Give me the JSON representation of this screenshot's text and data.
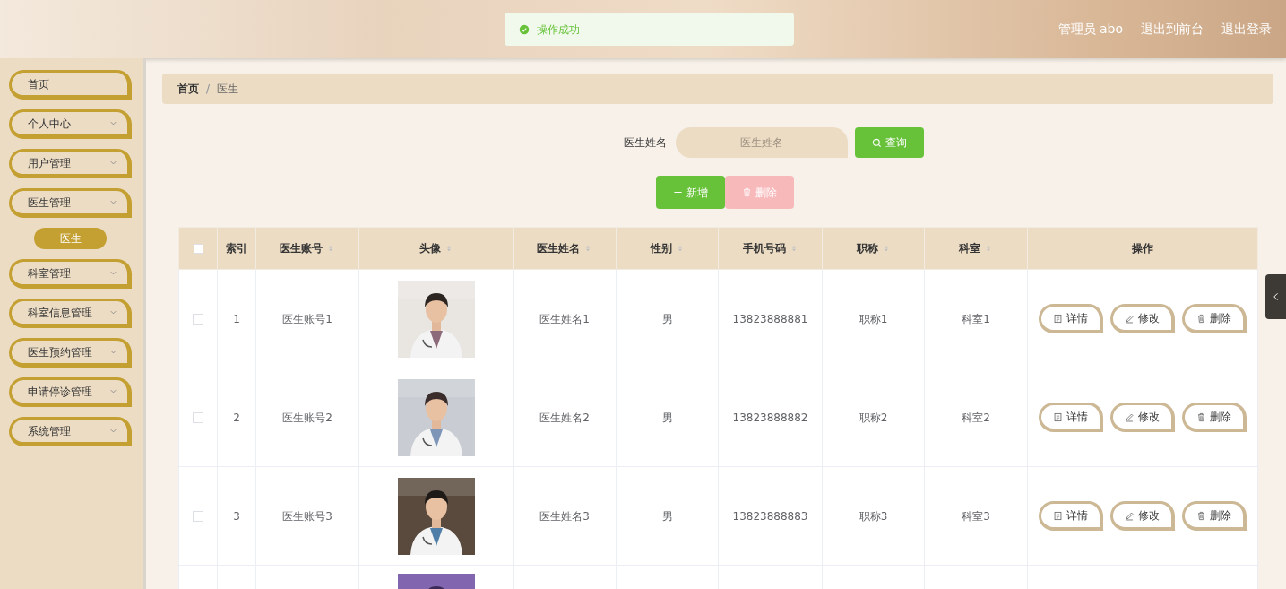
{
  "header": {
    "links": [
      "管理员 abo",
      "退出到前台",
      "退出登录"
    ]
  },
  "toast": {
    "message": "操作成功"
  },
  "sidebar": {
    "items": [
      {
        "label": "首页",
        "expandable": false
      },
      {
        "label": "个人中心",
        "expandable": true
      },
      {
        "label": "用户管理",
        "expandable": true
      },
      {
        "label": "医生管理",
        "expandable": true,
        "children": [
          {
            "label": "医生",
            "selected": true
          }
        ]
      },
      {
        "label": "科室管理",
        "expandable": true
      },
      {
        "label": "科室信息管理",
        "expandable": true
      },
      {
        "label": "医生预约管理",
        "expandable": true
      },
      {
        "label": "申请停诊管理",
        "expandable": true
      },
      {
        "label": "系统管理",
        "expandable": true
      }
    ]
  },
  "breadcrumb": {
    "separator": "/",
    "items": [
      "首页",
      "医生"
    ]
  },
  "search": {
    "label": "医生姓名",
    "placeholder": "医生姓名",
    "button": "查询"
  },
  "actions": [
    {
      "label": "新增",
      "kind": "add",
      "disabled": false
    },
    {
      "label": "删除",
      "kind": "delete",
      "disabled": true
    }
  ],
  "table": {
    "all_checked": false,
    "columns": [
      {
        "label": "索引",
        "sortable": false
      },
      {
        "label": "医生账号",
        "sortable": true
      },
      {
        "label": "头像",
        "sortable": true
      },
      {
        "label": "医生姓名",
        "sortable": true
      },
      {
        "label": "性别",
        "sortable": true
      },
      {
        "label": "手机号码",
        "sortable": true
      },
      {
        "label": "职称",
        "sortable": true
      },
      {
        "label": "科室",
        "sortable": true
      },
      {
        "label": "操作",
        "sortable": false
      }
    ],
    "rows": [
      {
        "checked": false,
        "cells": [
          "1",
          "医生账号1",
          null,
          "医生姓名1",
          "男",
          "13823888881",
          "职称1",
          "科室1"
        ],
        "buttons": [
          "详情",
          "修改",
          "删除"
        ]
      },
      {
        "checked": false,
        "cells": [
          "2",
          "医生账号2",
          null,
          "医生姓名2",
          "男",
          "13823888882",
          "职称2",
          "科室2"
        ],
        "buttons": [
          "详情",
          "修改",
          "删除"
        ]
      },
      {
        "checked": false,
        "cells": [
          "3",
          "医生账号3",
          null,
          "医生姓名3",
          "男",
          "13823888883",
          "职称3",
          "科室3"
        ],
        "buttons": [
          "详情",
          "修改",
          "删除"
        ]
      },
      {
        "partial": true
      }
    ]
  }
}
